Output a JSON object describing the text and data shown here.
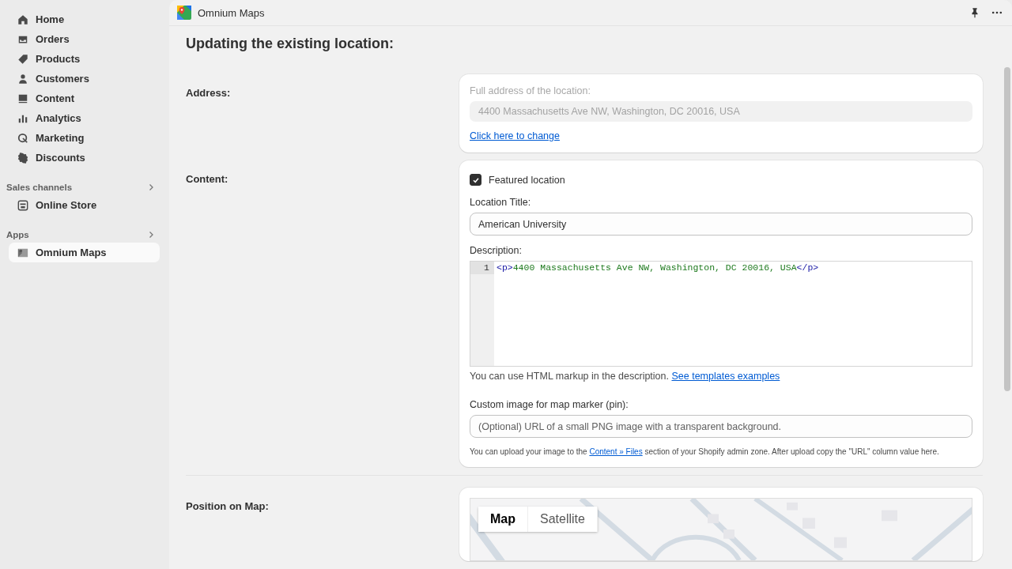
{
  "sidebar": {
    "main_items": [
      {
        "label": "Home",
        "selected": false
      },
      {
        "label": "Orders",
        "selected": false
      },
      {
        "label": "Products",
        "selected": false
      },
      {
        "label": "Customers",
        "selected": false
      },
      {
        "label": "Content",
        "selected": false
      },
      {
        "label": "Analytics",
        "selected": false
      },
      {
        "label": "Marketing",
        "selected": false
      },
      {
        "label": "Discounts",
        "selected": false
      }
    ],
    "sections": [
      {
        "title": "Sales channels",
        "items": [
          {
            "label": "Online Store",
            "selected": false
          }
        ]
      },
      {
        "title": "Apps",
        "items": [
          {
            "label": "Omnium Maps",
            "selected": true
          }
        ]
      }
    ]
  },
  "app_bar": {
    "title": "Omnium Maps"
  },
  "page": {
    "heading": "Updating the existing location:",
    "address": {
      "label": "Address:",
      "field_label": "Full address of the location:",
      "value": "4400 Massachusetts Ave NW, Washington, DC 20016, USA",
      "link": "Click here to change"
    },
    "content": {
      "label": "Content:",
      "featured": {
        "label": "Featured location",
        "checked": true
      },
      "title_label": "Location Title:",
      "title_value": "American University",
      "description_label": "Description:",
      "code_lines": [
        {
          "number": "1",
          "tokens": [
            {
              "kind": "tag",
              "text": "<p>"
            },
            {
              "kind": "text",
              "text": "4400 Massachusetts Ave NW, Washington, DC 20016, USA"
            },
            {
              "kind": "tag",
              "text": "</p>"
            }
          ]
        }
      ],
      "description_hint": {
        "text": "You can use HTML markup in the description.",
        "link": "See templates examples"
      },
      "marker_label": "Custom image for map marker (pin):",
      "marker_placeholder": "(Optional) URL of a small PNG image with a transparent background.",
      "marker_hint": {
        "before": "You can upload your image to the",
        "link": "Content » Files",
        "after": "section of your Shopify admin zone. After upload copy the \"URL\" column value here."
      }
    },
    "position": {
      "label": "Position on Map:",
      "map_types": [
        {
          "label": "Map",
          "selected": true
        },
        {
          "label": "Satellite",
          "selected": false
        }
      ]
    }
  }
}
